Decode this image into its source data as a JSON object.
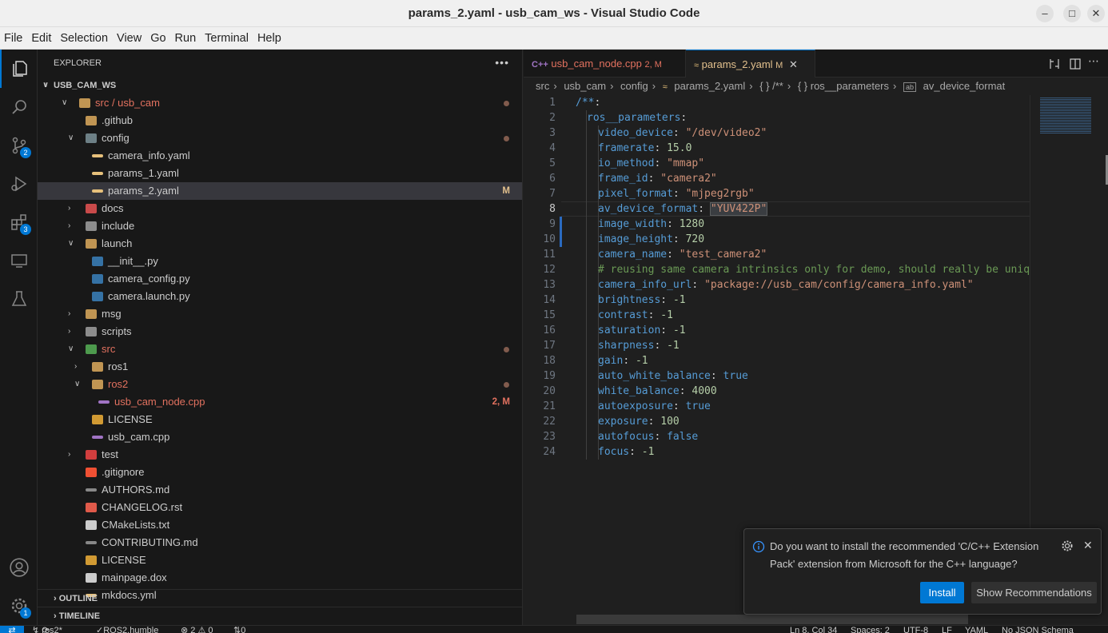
{
  "window": {
    "title": "params_2.yaml - usb_cam_ws - Visual Studio Code"
  },
  "menu": [
    "File",
    "Edit",
    "Selection",
    "View",
    "Go",
    "Run",
    "Terminal",
    "Help"
  ],
  "activity_badges": {
    "source_control": "2",
    "extensions": "3",
    "accounts": "1"
  },
  "explorer": {
    "header": "EXPLORER",
    "workspace": "USB_CAM_WS",
    "rows": [
      {
        "label": "src / usb_cam",
        "depth": 1,
        "twisty": "open",
        "icon": "folder-open",
        "color": "#e2715f",
        "dot": true
      },
      {
        "label": ".github",
        "depth": 2,
        "twisty": "",
        "icon": "folder",
        "color": "#cccccc"
      },
      {
        "label": "config",
        "depth": 2,
        "twisty": "open",
        "icon": "folder-config",
        "color": "#cccccc",
        "dot": true
      },
      {
        "label": "camera_info.yaml",
        "depth": 3,
        "twisty": "",
        "icon": "yaml",
        "color": "#cccccc"
      },
      {
        "label": "params_1.yaml",
        "depth": 3,
        "twisty": "",
        "icon": "yaml",
        "color": "#cccccc"
      },
      {
        "label": "params_2.yaml",
        "depth": 3,
        "twisty": "",
        "icon": "yaml",
        "color": "#cccccc",
        "status": "M",
        "status_color": "#e2c08d",
        "selected": true
      },
      {
        "label": "docs",
        "depth": 2,
        "twisty": "closed",
        "icon": "folder-docs",
        "color": "#cccccc"
      },
      {
        "label": "include",
        "depth": 2,
        "twisty": "closed",
        "icon": "folder-include",
        "color": "#cccccc"
      },
      {
        "label": "launch",
        "depth": 2,
        "twisty": "open",
        "icon": "folder",
        "color": "#cccccc"
      },
      {
        "label": "__init__.py",
        "depth": 3,
        "twisty": "",
        "icon": "python",
        "color": "#cccccc"
      },
      {
        "label": "camera_config.py",
        "depth": 3,
        "twisty": "",
        "icon": "python",
        "color": "#cccccc"
      },
      {
        "label": "camera.launch.py",
        "depth": 3,
        "twisty": "",
        "icon": "python",
        "color": "#cccccc"
      },
      {
        "label": "msg",
        "depth": 2,
        "twisty": "closed",
        "icon": "folder",
        "color": "#cccccc"
      },
      {
        "label": "scripts",
        "depth": 2,
        "twisty": "closed",
        "icon": "folder-scripts",
        "color": "#cccccc"
      },
      {
        "label": "src",
        "depth": 2,
        "twisty": "open",
        "icon": "folder-src",
        "color": "#e2715f",
        "dot": true
      },
      {
        "label": "ros1",
        "depth": 3,
        "twisty": "closed",
        "icon": "folder",
        "color": "#cccccc"
      },
      {
        "label": "ros2",
        "depth": 3,
        "twisty": "open",
        "icon": "folder-open",
        "color": "#e2715f",
        "dot": true
      },
      {
        "label": "usb_cam_node.cpp",
        "depth": 4,
        "twisty": "",
        "icon": "cpp",
        "color": "#e2715f",
        "status": "2, M",
        "status_color": "#e2715f"
      },
      {
        "label": "LICENSE",
        "depth": 3,
        "twisty": "",
        "icon": "license",
        "color": "#cccccc"
      },
      {
        "label": "usb_cam.cpp",
        "depth": 3,
        "twisty": "",
        "icon": "cpp",
        "color": "#cccccc"
      },
      {
        "label": "test",
        "depth": 2,
        "twisty": "closed",
        "icon": "folder-test",
        "color": "#cccccc"
      },
      {
        "label": ".gitignore",
        "depth": 2,
        "twisty": "",
        "icon": "git",
        "color": "#cccccc"
      },
      {
        "label": "AUTHORS.md",
        "depth": 2,
        "twisty": "",
        "icon": "markdown",
        "color": "#cccccc"
      },
      {
        "label": "CHANGELOG.rst",
        "depth": 2,
        "twisty": "",
        "icon": "rst",
        "color": "#cccccc"
      },
      {
        "label": "CMakeLists.txt",
        "depth": 2,
        "twisty": "",
        "icon": "text",
        "color": "#cccccc"
      },
      {
        "label": "CONTRIBUTING.md",
        "depth": 2,
        "twisty": "",
        "icon": "markdown",
        "color": "#cccccc"
      },
      {
        "label": "LICENSE",
        "depth": 2,
        "twisty": "",
        "icon": "license",
        "color": "#cccccc"
      },
      {
        "label": "mainpage.dox",
        "depth": 2,
        "twisty": "",
        "icon": "file",
        "color": "#cccccc"
      },
      {
        "label": "mkdocs.yml",
        "depth": 2,
        "twisty": "",
        "icon": "yaml",
        "color": "#cccccc"
      }
    ],
    "outline": "OUTLINE",
    "timeline": "TIMELINE"
  },
  "tabs": [
    {
      "label": "usb_cam_node.cpp",
      "suffix": "2, M",
      "color": "#e2715f",
      "active": false
    },
    {
      "label": "params_2.yaml",
      "suffix": "M",
      "color": "#e2c08d",
      "active": true
    }
  ],
  "breadcrumb": [
    "src",
    "usb_cam",
    "config",
    "params_2.yaml",
    "{ } /**",
    "{ } ros__parameters",
    "av_device_format"
  ],
  "editor": {
    "current_line": 8,
    "lines": [
      {
        "n": "1",
        "key": "/**",
        "tail": ":",
        "indent": 0
      },
      {
        "n": "2",
        "key": "ros__parameters",
        "tail": ":",
        "indent": 1
      },
      {
        "n": "3",
        "key": "video_device",
        "val": "\"/dev/video2\"",
        "type": "s",
        "indent": 2
      },
      {
        "n": "4",
        "key": "framerate",
        "val": "15.0",
        "type": "n",
        "indent": 2
      },
      {
        "n": "5",
        "key": "io_method",
        "val": "\"mmap\"",
        "type": "s",
        "indent": 2
      },
      {
        "n": "6",
        "key": "frame_id",
        "val": "\"camera2\"",
        "type": "s",
        "indent": 2
      },
      {
        "n": "7",
        "key": "pixel_format",
        "val": "\"mjpeg2rgb\"",
        "type": "s",
        "indent": 2
      },
      {
        "n": "8",
        "key": "av_device_format",
        "val": "\"YUV422P\"",
        "type": "s",
        "indent": 2,
        "highlight": true
      },
      {
        "n": "9",
        "key": "image_width",
        "val": "1280",
        "type": "n",
        "indent": 2
      },
      {
        "n": "10",
        "key": "image_height",
        "val": "720",
        "type": "n",
        "indent": 2
      },
      {
        "n": "11",
        "key": "camera_name",
        "val": "\"test_camera2\"",
        "type": "s",
        "indent": 2
      },
      {
        "n": "12",
        "comment": "# reusing same camera intrinsics only for demo, should really be unique for",
        "indent": 2
      },
      {
        "n": "13",
        "key": "camera_info_url",
        "val": "\"package://usb_cam/config/camera_info.yaml\"",
        "type": "s",
        "indent": 2
      },
      {
        "n": "14",
        "key": "brightness",
        "val": "-1",
        "type": "n",
        "indent": 2
      },
      {
        "n": "15",
        "key": "contrast",
        "val": "-1",
        "type": "n",
        "indent": 2
      },
      {
        "n": "16",
        "key": "saturation",
        "val": "-1",
        "type": "n",
        "indent": 2
      },
      {
        "n": "17",
        "key": "sharpness",
        "val": "-1",
        "type": "n",
        "indent": 2
      },
      {
        "n": "18",
        "key": "gain",
        "val": "-1",
        "type": "n",
        "indent": 2
      },
      {
        "n": "19",
        "key": "auto_white_balance",
        "val": "true",
        "type": "v",
        "indent": 2
      },
      {
        "n": "20",
        "key": "white_balance",
        "val": "4000",
        "type": "n",
        "indent": 2
      },
      {
        "n": "21",
        "key": "autoexposure",
        "val": "true",
        "type": "v",
        "indent": 2
      },
      {
        "n": "22",
        "key": "exposure",
        "val": "100",
        "type": "n",
        "indent": 2
      },
      {
        "n": "23",
        "key": "autofocus",
        "val": "false",
        "type": "v",
        "indent": 2
      },
      {
        "n": "24",
        "key": "focus",
        "val": "-1",
        "type": "n",
        "indent": 2
      }
    ]
  },
  "notification": {
    "message": "Do you want to install the recommended 'C/C++ Extension Pack' extension from Microsoft for the C++ language?",
    "install": "Install",
    "show": "Show Recommendations"
  },
  "status": {
    "branch": "ros2*",
    "ros": "ROS2.humble",
    "problems": "⊗ 2 ⚠ 0",
    "ports": "0",
    "position": "Ln 8, Col 34",
    "spaces": "Spaces: 2",
    "encoding": "UTF-8",
    "eol": "LF",
    "language": "YAML",
    "schema": "No JSON Schema"
  },
  "colors": {
    "accent": "#0078d4",
    "modified": "#e2c08d",
    "error": "#e2715f"
  }
}
